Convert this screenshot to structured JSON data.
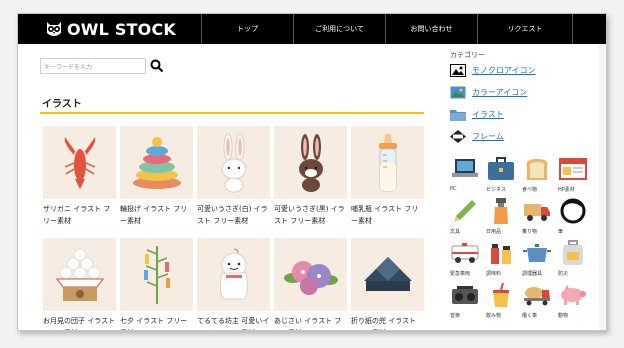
{
  "header": {
    "logo_text": "OWL STOCK",
    "nav": [
      "トップ",
      "ご利用について",
      "お問い合わせ",
      "リクエスト"
    ]
  },
  "search": {
    "placeholder": "キーワードを入力"
  },
  "section": {
    "title": "イラスト"
  },
  "cards": [
    {
      "caption": "ザリガニ イラスト フリー素材",
      "icon": "crayfish-icon"
    },
    {
      "caption": "輪投げ イラスト フリー素材",
      "icon": "ring-toss-icon"
    },
    {
      "caption": "可愛いうさぎ(白) イラスト フリー素材",
      "icon": "white-rabbit-icon"
    },
    {
      "caption": "可愛いうさぎ(黒) イラスト フリー素材",
      "icon": "black-rabbit-icon"
    },
    {
      "caption": "哺乳瓶 イラスト フリー素材",
      "icon": "baby-bottle-icon"
    },
    {
      "caption": "お月見の団子 イラスト フリー素材",
      "icon": "moon-dango-icon"
    },
    {
      "caption": "七夕 イラスト フリー素材",
      "icon": "tanabata-icon"
    },
    {
      "caption": "てるてる坊主 可愛いイラスト フリー素材",
      "icon": "teru-teru-bozu-icon"
    },
    {
      "caption": "あじさい イラスト フリー素材",
      "icon": "hydrangea-icon"
    },
    {
      "caption": "折り紙の兜 イラスト フリー素材",
      "icon": "origami-helmet-icon"
    }
  ],
  "sidebar": {
    "category_title": "カテゴリー",
    "categories": [
      {
        "label": "モノクロアイコン",
        "icon": "monochrome-image-icon"
      },
      {
        "label": "カラーアイコン",
        "icon": "color-image-icon"
      },
      {
        "label": "イラスト",
        "icon": "folder-icon"
      },
      {
        "label": "フレーム",
        "icon": "frame-icon"
      }
    ],
    "icon_grid": [
      {
        "label": "PC",
        "icon": "laptop-icon"
      },
      {
        "label": "ビジネス",
        "icon": "briefcase-icon"
      },
      {
        "label": "食べ物",
        "icon": "bread-icon"
      },
      {
        "label": "HP素材",
        "icon": "webpage-icon"
      },
      {
        "label": "文具",
        "icon": "pencil-icon"
      },
      {
        "label": "日用品",
        "icon": "spray-bottle-icon"
      },
      {
        "label": "乗り物",
        "icon": "truck-icon"
      },
      {
        "label": "筆",
        "icon": "brush-stroke-icon"
      },
      {
        "label": "緊急車両",
        "icon": "ambulance-icon"
      },
      {
        "label": "調味料",
        "icon": "seasoning-icon"
      },
      {
        "label": "調理器具",
        "icon": "pot-icon"
      },
      {
        "label": "防災",
        "icon": "emergency-bag-icon"
      },
      {
        "label": "音楽",
        "icon": "radio-icon"
      },
      {
        "label": "飲み物",
        "icon": "drink-icon"
      },
      {
        "label": "働く車",
        "icon": "mixer-truck-icon"
      },
      {
        "label": "動物",
        "icon": "pig-icon"
      }
    ]
  },
  "colors": {
    "header_bg": "#000000",
    "accent_rule": "#f2c511",
    "link": "#1a6fd8",
    "thumb_bg": "#f6ece1"
  }
}
